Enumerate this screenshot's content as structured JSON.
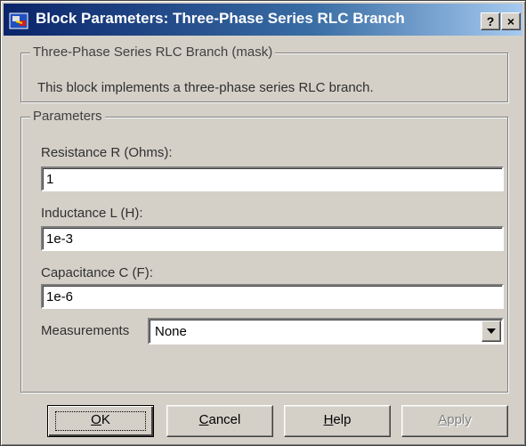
{
  "window": {
    "title": "Block Parameters: Three-Phase Series RLC Branch",
    "help_button": "?",
    "close_button": "×"
  },
  "mask": {
    "group_title": "Three-Phase Series RLC Branch (mask)",
    "description": "This block implements a three-phase series RLC branch."
  },
  "parameters": {
    "group_title": "Parameters",
    "resistance": {
      "label": "Resistance R (Ohms):",
      "value": "1"
    },
    "inductance": {
      "label": "Inductance L (H):",
      "value": "1e-3"
    },
    "capacitance": {
      "label": "Capacitance C (F):",
      "value": "1e-6"
    },
    "measurements": {
      "label": "Measurements",
      "value": "None"
    }
  },
  "buttons": {
    "ok": {
      "mnemonic": "O",
      "rest": "K"
    },
    "cancel": {
      "mnemonic": "C",
      "rest": "ancel"
    },
    "help": {
      "mnemonic": "H",
      "rest": "elp"
    },
    "apply": {
      "mnemonic": "A",
      "rest": "pply"
    }
  }
}
